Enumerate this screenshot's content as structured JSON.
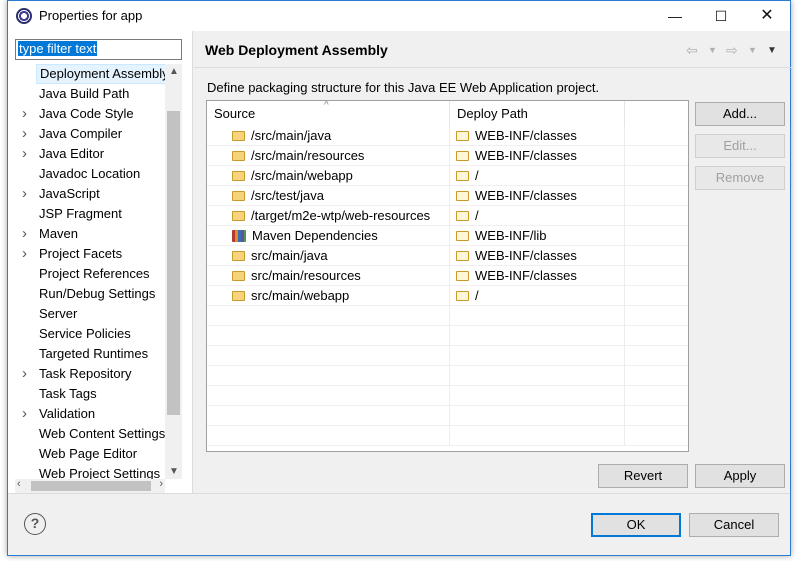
{
  "window": {
    "title": "Properties for app",
    "controls": {
      "minimize": "—",
      "maximize": "☐",
      "close": "✕"
    }
  },
  "sidebar": {
    "filter_placeholder": "type filter text",
    "items": [
      {
        "label": "Deployment Assembly",
        "expandable": false,
        "selected": true
      },
      {
        "label": "Java Build Path",
        "expandable": false
      },
      {
        "label": "Java Code Style",
        "expandable": true
      },
      {
        "label": "Java Compiler",
        "expandable": true
      },
      {
        "label": "Java Editor",
        "expandable": true
      },
      {
        "label": "Javadoc Location",
        "expandable": false
      },
      {
        "label": "JavaScript",
        "expandable": true
      },
      {
        "label": "JSP Fragment",
        "expandable": false
      },
      {
        "label": "Maven",
        "expandable": true
      },
      {
        "label": "Project Facets",
        "expandable": true
      },
      {
        "label": "Project References",
        "expandable": false
      },
      {
        "label": "Run/Debug Settings",
        "expandable": false
      },
      {
        "label": "Server",
        "expandable": false
      },
      {
        "label": "Service Policies",
        "expandable": false
      },
      {
        "label": "Targeted Runtimes",
        "expandable": false
      },
      {
        "label": "Task Repository",
        "expandable": true
      },
      {
        "label": "Task Tags",
        "expandable": false
      },
      {
        "label": "Validation",
        "expandable": true
      },
      {
        "label": "Web Content Settings",
        "expandable": false
      },
      {
        "label": "Web Page Editor",
        "expandable": false
      },
      {
        "label": "Web Project Settings",
        "expandable": false
      }
    ]
  },
  "page": {
    "title": "Web Deployment Assembly",
    "description": "Define packaging structure for this Java EE Web Application project."
  },
  "table": {
    "columns": [
      "Source",
      "Deploy Path"
    ],
    "rows": [
      {
        "source": "/src/main/java",
        "deploy": "WEB-INF/classes",
        "icon": "folder-icon"
      },
      {
        "source": "/src/main/resources",
        "deploy": "WEB-INF/classes",
        "icon": "folder-icon"
      },
      {
        "source": "/src/main/webapp",
        "deploy": "/",
        "icon": "folder-icon"
      },
      {
        "source": "/src/test/java",
        "deploy": "WEB-INF/classes",
        "icon": "folder-icon"
      },
      {
        "source": "/target/m2e-wtp/web-resources",
        "deploy": "/",
        "icon": "folder-icon"
      },
      {
        "source": "Maven Dependencies",
        "deploy": "WEB-INF/lib",
        "icon": "maven-library-icon"
      },
      {
        "source": "src/main/java",
        "deploy": "WEB-INF/classes",
        "icon": "folder-icon"
      },
      {
        "source": "src/main/resources",
        "deploy": "WEB-INF/classes",
        "icon": "folder-icon"
      },
      {
        "source": "src/main/webapp",
        "deploy": "/",
        "icon": "folder-icon"
      }
    ]
  },
  "buttons": {
    "add": "Add...",
    "edit": "Edit...",
    "remove": "Remove",
    "revert": "Revert",
    "apply": "Apply",
    "ok": "OK",
    "cancel": "Cancel",
    "help": "?"
  },
  "colors": {
    "accent": "#0078d7",
    "selection_bg": "#e5f3ff",
    "folder": "#f5d37a"
  }
}
